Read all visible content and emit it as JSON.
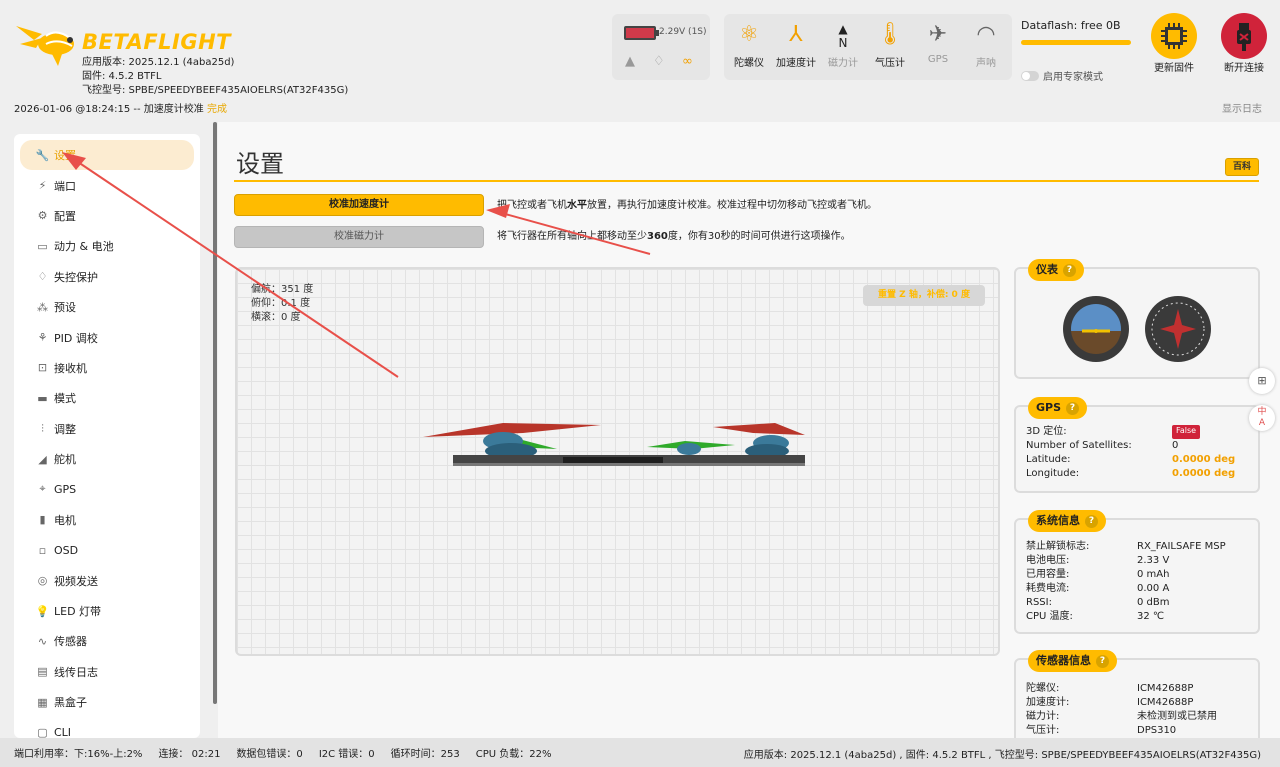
{
  "header": {
    "brand_part1": "BETA",
    "brand_part2": "FLIGHT",
    "app_version": "应用版本: 2025.12.1 (4aba25d)",
    "firmware": "固件: 4.5.2 BTFL",
    "board": "飞控型号: SPBE/SPEEDYBEEF435AIOELRS(AT32F435G)",
    "timestamp": "2026-01-06 @18:24:15 -- 加速度计校准",
    "timestamp_status": "完成",
    "show_log": "显示日志",
    "battery_text": "2.29V (1S)",
    "dataflash": "Dataflash: free 0B",
    "expert_mode": "启用专家模式",
    "update_firmware": "更新固件",
    "disconnect": "断开连接",
    "sensors": [
      {
        "label": "陀螺仪",
        "icon": "gyro-icon",
        "active": true
      },
      {
        "label": "加速度计",
        "icon": "accelerometer-icon",
        "active": true
      },
      {
        "label": "磁力计",
        "icon": "compass-icon",
        "active": false
      },
      {
        "label": "气压计",
        "icon": "barometer-icon",
        "active": true
      },
      {
        "label": "GPS",
        "icon": "satellite-icon",
        "active": false
      },
      {
        "label": "声呐",
        "icon": "sonar-icon",
        "active": false
      }
    ],
    "compass_letter": "N"
  },
  "sidebar": {
    "items": [
      {
        "label": "设置",
        "icon": "wrench-icon",
        "active": true
      },
      {
        "label": "端口",
        "icon": "plug-icon"
      },
      {
        "label": "配置",
        "icon": "gear-icon"
      },
      {
        "label": "动力 & 电池",
        "icon": "battery-icon"
      },
      {
        "label": "失控保护",
        "icon": "parachute-icon"
      },
      {
        "label": "预设",
        "icon": "magic-wand-icon"
      },
      {
        "label": "PID 调校",
        "icon": "pid-icon"
      },
      {
        "label": "接收机",
        "icon": "receiver-icon"
      },
      {
        "label": "模式",
        "icon": "toggle-icon"
      },
      {
        "label": "调整",
        "icon": "sliders-icon"
      },
      {
        "label": "舵机",
        "icon": "servo-icon"
      },
      {
        "label": "GPS",
        "icon": "gps-icon"
      },
      {
        "label": "电机",
        "icon": "motor-icon"
      },
      {
        "label": "OSD",
        "icon": "osd-icon"
      },
      {
        "label": "视频发送",
        "icon": "broadcast-icon"
      },
      {
        "label": "LED 灯带",
        "icon": "led-icon"
      },
      {
        "label": "传感器",
        "icon": "pulse-icon"
      },
      {
        "label": "线传日志",
        "icon": "log-icon"
      },
      {
        "label": "黑盒子",
        "icon": "blackbox-icon"
      },
      {
        "label": "CLI",
        "icon": "terminal-icon"
      }
    ]
  },
  "main": {
    "title": "设置",
    "wiki": "百科",
    "calibrate_acc": "校准加速度计",
    "calibrate_mag": "校准磁力计",
    "desc_acc_pre": "把飞控或者飞机",
    "desc_acc_bold": "水平",
    "desc_acc_post": "放置，再执行加速度计校准。校准过程中切勿移动飞控或者飞机。",
    "desc_mag_pre": "将飞行器在所有轴向上都移动至少",
    "desc_mag_bold": "360",
    "desc_mag_post": "度，你有30秒的时间可供进行这项操作。",
    "heading": "偏航：351 度",
    "pitch": "俯仰：0.1 度",
    "roll": "横滚：0 度",
    "reset_z": "重置 Z 轴，补偿: 0 度"
  },
  "panels": {
    "instruments": {
      "title": "仪表"
    },
    "gps": {
      "title": "GPS",
      "rows": [
        {
          "k": "3D 定位:",
          "v": "False"
        },
        {
          "k": "Number of Satellites:",
          "v": "0"
        },
        {
          "k": "Latitude:",
          "v": "0.0000 deg"
        },
        {
          "k": "Longitude:",
          "v": "0.0000 deg"
        }
      ]
    },
    "system": {
      "title": "系统信息",
      "rows": [
        {
          "k": "禁止解锁标志:",
          "v": "RX_FAILSAFE  MSP"
        },
        {
          "k": "电池电压:",
          "v": "2.33 V"
        },
        {
          "k": "已用容量:",
          "v": "0 mAh"
        },
        {
          "k": "耗费电流:",
          "v": "0.00 A"
        },
        {
          "k": "RSSI:",
          "v": "0 dBm"
        },
        {
          "k": "CPU 温度:",
          "v": "32 ℃"
        }
      ]
    },
    "sensor_info": {
      "title": "传感器信息",
      "rows": [
        {
          "k": "陀螺仪:",
          "v": "ICM42688P"
        },
        {
          "k": "加速度计:",
          "v": "ICM42688P"
        },
        {
          "k": "磁力计:",
          "v": "未检测到或已禁用"
        },
        {
          "k": "气压计:",
          "v": "DPS310"
        }
      ]
    }
  },
  "statusbar": {
    "port_util": "端口利用率：下:16%-上:2%",
    "connection": "连接： 02:21",
    "packet_err": "数据包错误：0",
    "i2c_err": "I2C 错误：0",
    "cycle": "循环时间：253",
    "cpu": "CPU 负载：22%",
    "right": "应用版本: 2025.12.1 (4aba25d) , 固件: 4.5.2 BTFL , 飞控型号: SPBE/SPEEDYBEEF435AIOELRS(AT32F435G)"
  },
  "floaters": {
    "translate_label": "中\nA"
  },
  "colors": {
    "accent": "#ffbb00",
    "danger": "#d0233a"
  }
}
